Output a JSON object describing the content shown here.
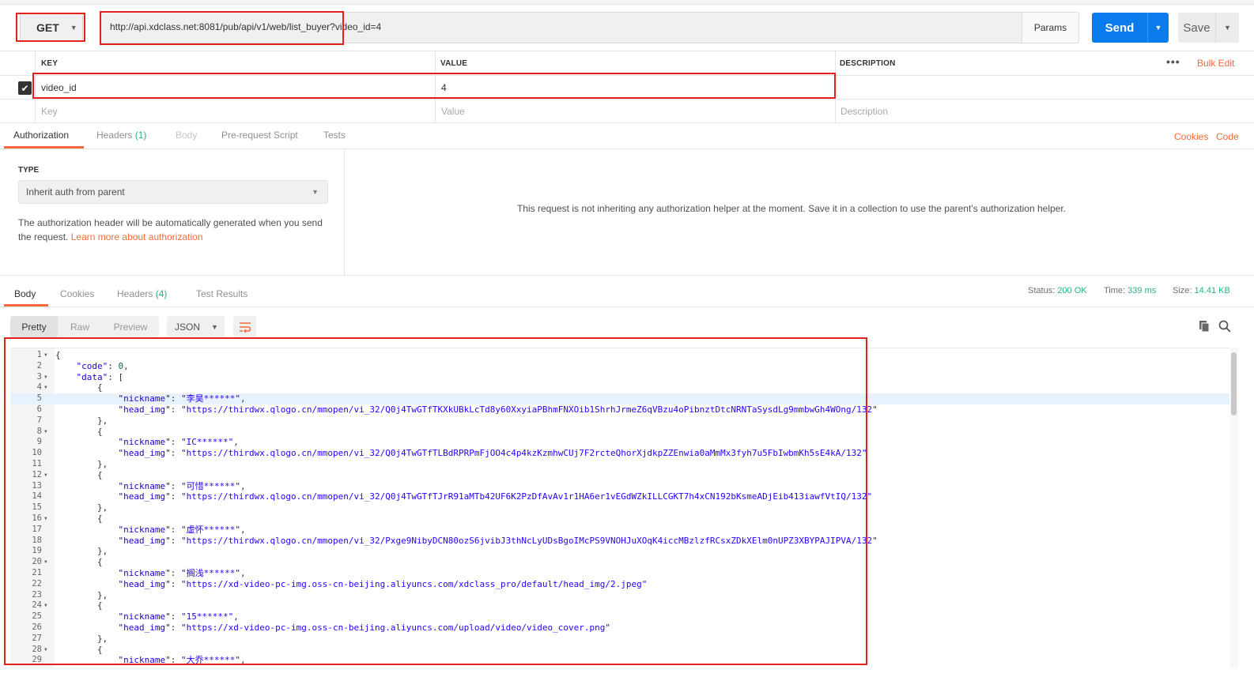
{
  "request": {
    "method": "GET",
    "url": "http://api.xdclass.net:8081/pub/api/v1/web/list_buyer?video_id=4",
    "params_label": "Params",
    "send_label": "Send",
    "save_label": "Save"
  },
  "params_table": {
    "headers": {
      "key": "KEY",
      "value": "VALUE",
      "description": "DESCRIPTION"
    },
    "bulk_edit": "Bulk Edit",
    "more": "•••",
    "rows": [
      {
        "key": "video_id",
        "value": "4",
        "description": ""
      }
    ],
    "placeholders": {
      "key": "Key",
      "value": "Value",
      "description": "Description"
    }
  },
  "request_tabs": {
    "authorization": "Authorization",
    "headers": "Headers",
    "headers_count": "(1)",
    "body": "Body",
    "prerequest": "Pre-request Script",
    "tests": "Tests",
    "cookies": "Cookies",
    "code": "Code"
  },
  "auth": {
    "type_label": "TYPE",
    "type_value": "Inherit auth from parent",
    "help_text": "The authorization header will be automatically generated when you send the request. ",
    "help_link": "Learn more about authorization",
    "message": "This request is not inheriting any authorization helper at the moment. Save it in a collection to use the parent's authorization helper."
  },
  "response_tabs": {
    "body": "Body",
    "cookies": "Cookies",
    "headers": "Headers",
    "headers_count": "(4)",
    "test_results": "Test Results"
  },
  "response_status": {
    "status_label": "Status:",
    "status_value": "200 OK",
    "time_label": "Time:",
    "time_value": "339 ms",
    "size_label": "Size:",
    "size_value": "14.41 KB"
  },
  "format_bar": {
    "pretty": "Pretty",
    "raw": "Raw",
    "preview": "Preview",
    "type": "JSON"
  },
  "icons": {
    "wrap": "wrap-lines-icon",
    "copy": "copy-icon",
    "search": "search-icon",
    "check": "checkmark-icon",
    "dropdown": "chevron-down-icon"
  },
  "colors": {
    "send_blue": "#097bed",
    "link_orange": "#f26b3a",
    "status_green": "#26b47f",
    "annotation_red": "#e3201b",
    "json_string": "#2a00ff",
    "json_number": "#164"
  },
  "response_lines": [
    {
      "n": "1",
      "fold": true,
      "text": "{"
    },
    {
      "n": "2",
      "fold": false,
      "text": "    \"code\": 0,"
    },
    {
      "n": "3",
      "fold": true,
      "text": "    \"data\": ["
    },
    {
      "n": "4",
      "fold": true,
      "text": "        {"
    },
    {
      "n": "5",
      "fold": false,
      "text": "            \"nickname\": \"李昊******\","
    },
    {
      "n": "6",
      "fold": false,
      "text": "            \"head_img\": \"https://thirdwx.qlogo.cn/mmopen/vi_32/Q0j4TwGTfTKXkUBkLcTd8y60XxyiaPBhmFNXOib1ShrhJrmeZ6qVBzu4oPibnztDtcNRNTaSysdLg9mmbwGh4WOng/132\""
    },
    {
      "n": "7",
      "fold": false,
      "text": "        },"
    },
    {
      "n": "8",
      "fold": true,
      "text": "        {"
    },
    {
      "n": "9",
      "fold": false,
      "text": "            \"nickname\": \"IC******\","
    },
    {
      "n": "10",
      "fold": false,
      "text": "            \"head_img\": \"https://thirdwx.qlogo.cn/mmopen/vi_32/Q0j4TwGTfTLBdRPRPmFjOO4c4p4kzKzmhwCUj7F2rcteQhorXjdkpZZEnwia0aMmMx3fyh7u5FbIwbmKh5sE4kA/132\""
    },
    {
      "n": "11",
      "fold": false,
      "text": "        },"
    },
    {
      "n": "12",
      "fold": true,
      "text": "        {"
    },
    {
      "n": "13",
      "fold": false,
      "text": "            \"nickname\": \"可惜******\","
    },
    {
      "n": "14",
      "fold": false,
      "text": "            \"head_img\": \"https://thirdwx.qlogo.cn/mmopen/vi_32/Q0j4TwGTfTJrR91aMTb42UF6K2PzDfAvAv1r1HA6er1vEGdWZkILLCGKT7h4xCN192bKsmeADjEib413iawfVtIQ/132\""
    },
    {
      "n": "15",
      "fold": false,
      "text": "        },"
    },
    {
      "n": "16",
      "fold": true,
      "text": "        {"
    },
    {
      "n": "17",
      "fold": false,
      "text": "            \"nickname\": \"虚怀******\","
    },
    {
      "n": "18",
      "fold": false,
      "text": "            \"head_img\": \"https://thirdwx.qlogo.cn/mmopen/vi_32/Pxge9NibyDCN80ozS6jvibJ3thNcLyUDsBgoIMcPS9VNOHJuXOqK4iccMBzlzfRCsxZDkXElm0nUPZ3XBYPAJIPVA/132\""
    },
    {
      "n": "19",
      "fold": false,
      "text": "        },"
    },
    {
      "n": "20",
      "fold": true,
      "text": "        {"
    },
    {
      "n": "21",
      "fold": false,
      "text": "            \"nickname\": \"搁浅******\","
    },
    {
      "n": "22",
      "fold": false,
      "text": "            \"head_img\": \"https://xd-video-pc-img.oss-cn-beijing.aliyuncs.com/xdclass_pro/default/head_img/2.jpeg\""
    },
    {
      "n": "23",
      "fold": false,
      "text": "        },"
    },
    {
      "n": "24",
      "fold": true,
      "text": "        {"
    },
    {
      "n": "25",
      "fold": false,
      "text": "            \"nickname\": \"15******\","
    },
    {
      "n": "26",
      "fold": false,
      "text": "            \"head_img\": \"https://xd-video-pc-img.oss-cn-beijing.aliyuncs.com/upload/video/video_cover.png\""
    },
    {
      "n": "27",
      "fold": false,
      "text": "        },"
    },
    {
      "n": "28",
      "fold": true,
      "text": "        {"
    },
    {
      "n": "29",
      "fold": false,
      "text": "            \"nickname\": \"大乔******\","
    }
  ]
}
